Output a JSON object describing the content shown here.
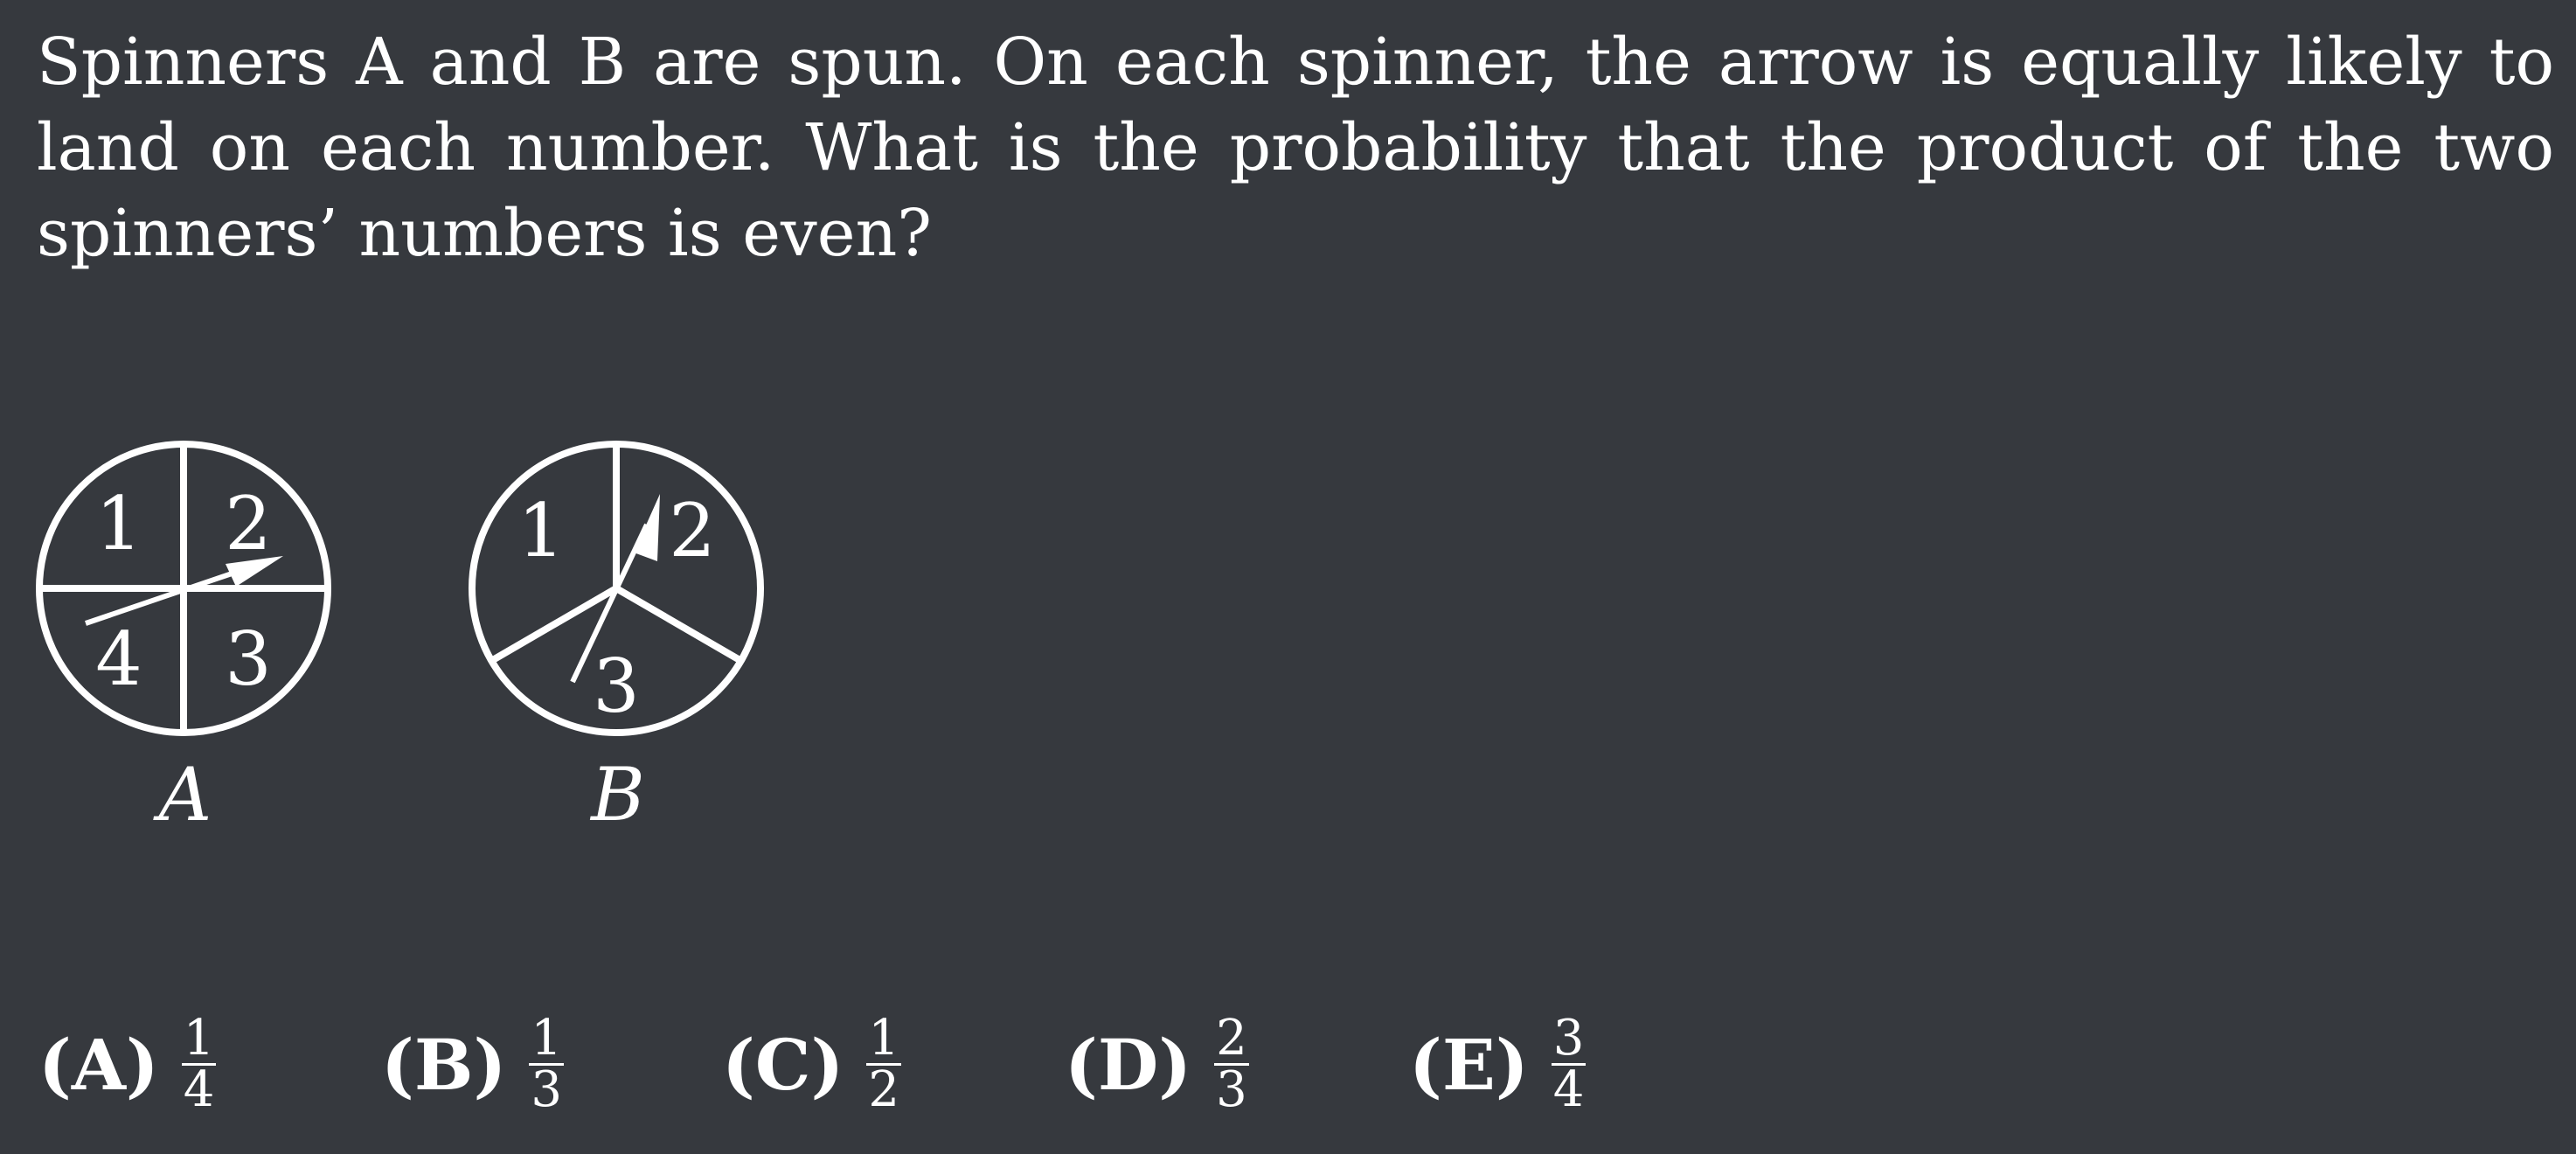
{
  "question": "Spinners A and B are spun. On each spinner, the arrow is equally likely to land on each number. What is the probability that the product of the two spinners’ numbers is even?",
  "spinners": {
    "a": {
      "label": "A",
      "sections": [
        "1",
        "2",
        "3",
        "4"
      ]
    },
    "b": {
      "label": "B",
      "sections": [
        "1",
        "2",
        "3"
      ]
    }
  },
  "choices": [
    {
      "letter": "(A)",
      "numerator": "1",
      "denominator": "4"
    },
    {
      "letter": "(B)",
      "numerator": "1",
      "denominator": "3"
    },
    {
      "letter": "(C)",
      "numerator": "1",
      "denominator": "2"
    },
    {
      "letter": "(D)",
      "numerator": "2",
      "denominator": "3"
    },
    {
      "letter": "(E)",
      "numerator": "3",
      "denominator": "4"
    }
  ]
}
